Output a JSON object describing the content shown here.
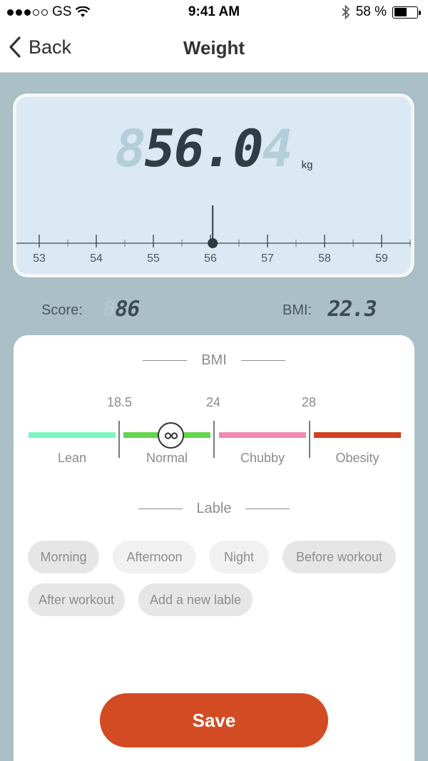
{
  "status_bar": {
    "carrier": "GS",
    "time": "9:41 AM",
    "battery_text": "58 %",
    "battery_level": 0.58,
    "signal_bars_filled": 3,
    "signal_bars_total": 5
  },
  "nav": {
    "back_label": "Back",
    "title": "Weight"
  },
  "scale": {
    "reading_ghost": "8",
    "reading_main": "56.0",
    "reading_last": "4",
    "unit": "kg",
    "ruler_ticks": [
      "53",
      "54",
      "55",
      "56",
      "57",
      "58",
      "59"
    ],
    "ruler_value": 56.04
  },
  "metrics": {
    "score_label": "Score:",
    "score_ghost": "8",
    "score_value": "86",
    "bmi_label": "BMI:",
    "bmi_value": "22.3"
  },
  "bmi_section": {
    "title": "BMI",
    "thresholds": [
      "18.5",
      "24",
      "28"
    ],
    "categories": [
      {
        "label": "Lean",
        "color": "#7df5c3"
      },
      {
        "label": "Normal",
        "color": "#62d64c"
      },
      {
        "label": "Chubby",
        "color": "#f28ab0"
      },
      {
        "label": "Obesity",
        "color": "#cf4023"
      }
    ],
    "current_category": "Normal"
  },
  "label_section": {
    "title": "Lable",
    "chips": [
      "Morning",
      "Afternoon",
      "Night",
      "Before workout",
      "After workout",
      "Add a new lable"
    ]
  },
  "save_label": "Save",
  "colors": {
    "background": "#abbfc6",
    "accent": "#d34b23",
    "lcd_panel": "#dae9f3"
  }
}
